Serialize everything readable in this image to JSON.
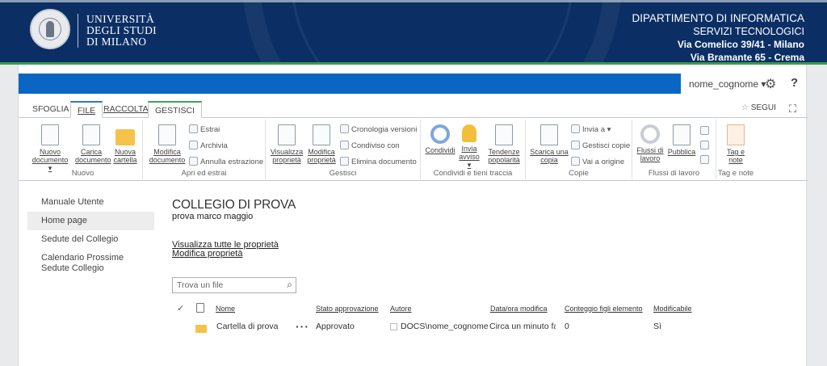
{
  "header": {
    "university": [
      "UNIVERSITÀ",
      "DEGLI STUDI",
      "DI MILANO"
    ],
    "department": "DIPARTIMENTO DI INFORMATICA",
    "service": "SERVIZI TECNOLOGICI",
    "address_1": "Via Comelico 39/41 - Milano",
    "address_2": "Via Bramante 65 - Crema"
  },
  "topbar": {
    "user": "nome_cognome ▾",
    "settings_icon": "gear-icon",
    "help": "?"
  },
  "tabs": [
    {
      "label": "SFOGLIA"
    },
    {
      "label": "FILE"
    },
    {
      "label": "RACCOLTA"
    },
    {
      "label": "GESTISCI"
    }
  ],
  "segui": "SEGUI",
  "ribbon": {
    "groups": [
      {
        "label": "Nuovo"
      },
      {
        "label": "Apri ed estrai"
      },
      {
        "label": "Gestisci"
      },
      {
        "label": "Condividi e tieni traccia"
      },
      {
        "label": "Copie"
      },
      {
        "label": "Flussi di lavoro"
      },
      {
        "label": "Tag e note"
      }
    ],
    "nuovo_documento": [
      "Nuovo",
      "documento ▾"
    ],
    "carica_documento": [
      "Carica",
      "documento"
    ],
    "nuova_cartella": [
      "Nuova",
      "cartella"
    ],
    "modifica_documento": [
      "Modifica",
      "documento"
    ],
    "estrai": "Estrai",
    "archivia": "Archivia",
    "annulla_estrazione": "Annulla estrazione",
    "visualizza_proprieta": [
      "Visualizza",
      "proprietà"
    ],
    "modifica_proprieta": [
      "Modifica",
      "proprietà"
    ],
    "cronologia_versioni": "Cronologia versioni",
    "condiviso_con": "Condiviso con",
    "elimina_documento": "Elimina documento",
    "condividi": "Condividi",
    "invia_avviso": [
      "Invia",
      "avviso ▾"
    ],
    "tendenze_popolarita": [
      "Tendenze",
      "popolarità"
    ],
    "scarica_copia": [
      "Scarica una",
      "copia"
    ],
    "invia_a": "Invia a ▾",
    "gestisci_copie": "Gestisci copie",
    "vai_origine": "Vai a origine",
    "flussi_lavoro": [
      "Flussi di",
      "lavoro"
    ],
    "pubblica": "Pubblica",
    "tag_note": [
      "Tag e",
      "note"
    ]
  },
  "nav": [
    {
      "label": "Manuale Utente"
    },
    {
      "label": "Home page"
    },
    {
      "label": "Sedute del Collegio"
    },
    {
      "label": "Calendario Prossime Sedute Collegio"
    }
  ],
  "main": {
    "title": "COLLEGIO DI PROVA",
    "subtitle": "prova marco maggio",
    "link_view_props": "Visualizza tutte le proprietà",
    "link_edit_props": "Modifica proprietà",
    "search_placeholder": "Trova un file"
  },
  "table": {
    "headers": [
      "Nome",
      "Stato approvazione",
      "Autore",
      "Data/ora modifica",
      "Conteggio figli elemento",
      "Modificabile"
    ],
    "rows": [
      {
        "name": "Cartella di prova",
        "stato": "Approvato",
        "autore": "DOCS\\nome_cognome",
        "data": "Circa un minuto fa",
        "conteggio": "0",
        "modificabile": "Sì"
      }
    ]
  },
  "colors": {
    "banner": "#0b2f65",
    "accent_blue": "#0a66c2",
    "accent_green": "#3a9a4b"
  }
}
